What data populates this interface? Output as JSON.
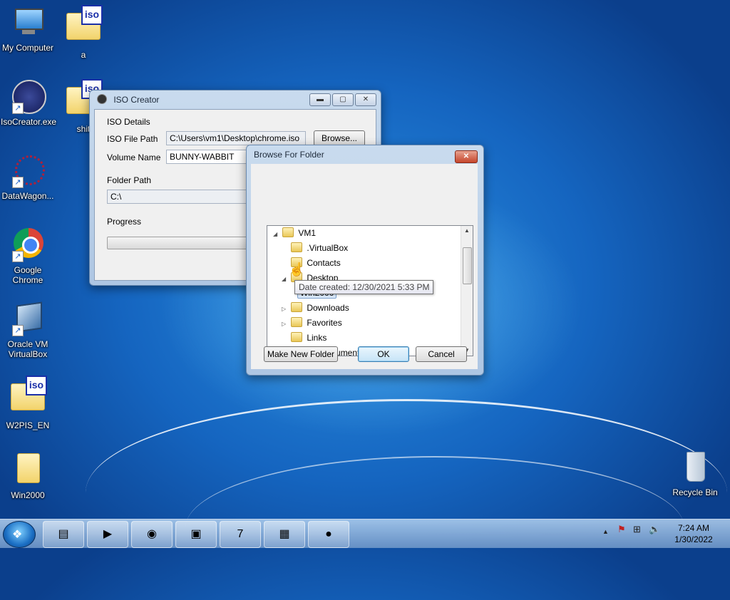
{
  "desktop": {
    "icons": [
      {
        "label": "My Computer"
      },
      {
        "label": "a",
        "badge": "iso"
      },
      {
        "label": "IsoCreator.exe"
      },
      {
        "label": "shit",
        "badge": "iso"
      },
      {
        "label": "DataWagon..."
      },
      {
        "label": "Google Chrome"
      },
      {
        "label": "Oracle VM VirtualBox"
      },
      {
        "label": "W2PIS_EN",
        "badge": "iso"
      },
      {
        "label": "Win2000"
      },
      {
        "label": "Recycle Bin"
      }
    ]
  },
  "iso_creator": {
    "title": "ISO Creator",
    "details_group": "ISO Details",
    "iso_path_label": "ISO File Path",
    "iso_path_value": "C:\\Users\\vm1\\Desktop\\chrome.iso",
    "browse_label": "Browse...",
    "volume_label": "Volume Name",
    "volume_value": "BUNNY-WABBIT",
    "folder_group": "Folder Path",
    "folder_value": "C:\\",
    "progress_group": "Progress",
    "progress": 0,
    "caption_min": "▬",
    "caption_max": "▢",
    "caption_close": "✕"
  },
  "browse_dialog": {
    "title": "Browse For Folder",
    "close": "✕",
    "tree": [
      {
        "label": "VM1",
        "expander": "◢"
      },
      {
        "label": ".VirtualBox",
        "expander": ""
      },
      {
        "label": "Contacts",
        "expander": ""
      },
      {
        "label": "Desktop",
        "expander": "◢"
      },
      {
        "label": "Win2000",
        "expander": ""
      },
      {
        "label": "Downloads",
        "expander": "▷"
      },
      {
        "label": "Favorites",
        "expander": "▷"
      },
      {
        "label": "Links",
        "expander": ""
      },
      {
        "label": "My Documents",
        "expander": ""
      }
    ],
    "tooltip": "Date created: 12/30/2021 5:33 PM",
    "make_new_folder": "Make New Folder",
    "ok": "OK",
    "cancel": "Cancel"
  },
  "taskbar": {
    "time": "7:24 AM",
    "date": "1/30/2022",
    "tray_up_arrow": "▲"
  }
}
